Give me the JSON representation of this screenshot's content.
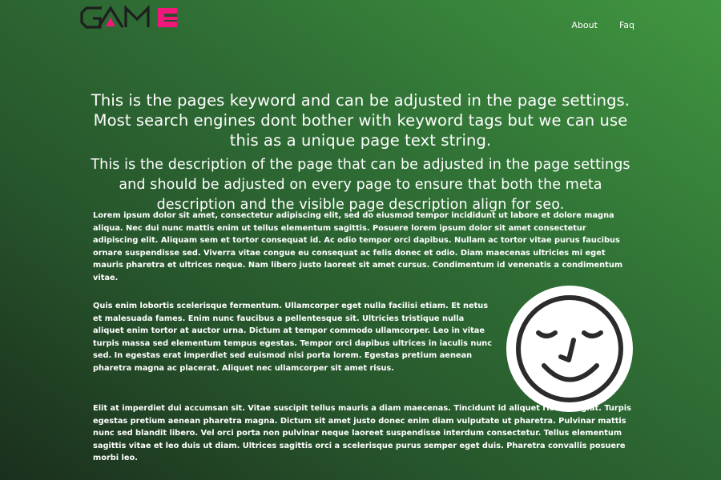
{
  "brand": {
    "logo_text": "GAME",
    "accent_color": "#f0187a"
  },
  "nav": {
    "about_label": "About",
    "faq_label": "Faq"
  },
  "hero": {
    "keyword": "This is the pages keyword and can be adjusted in the page settings. Most search engines dont bother with keyword tags but we can use this as a unique page text string.",
    "description": "This is the description of the page that can be adjusted in the page settings and should be adjusted on every page to ensure that both the meta description and the visible page description align for seo."
  },
  "content": {
    "paragraph_1": "Lorem ipsum dolor sit amet, consectetur adipiscing elit, sed do eiusmod tempor incididunt ut labore et dolore magna aliqua. Nec dui nunc mattis enim ut tellus elementum sagittis. Posuere lorem ipsum dolor sit amet consectetur adipiscing elit. Aliquam sem et tortor consequat id. Ac odio tempor orci dapibus. Nullam ac tortor vitae purus faucibus ornare suspendisse sed. Viverra vitae congue eu consequat ac felis donec et odio. Diam maecenas ultricies mi eget mauris pharetra et ultrices neque. Nam libero justo laoreet sit amet cursus. Condimentum id venenatis a condimentum vitae.",
    "paragraph_2": "Quis enim lobortis scelerisque fermentum. Ullamcorper eget nulla facilisi etiam. Et netus et malesuada fames. Enim nunc faucibus a pellentesque sit. Ultricies tristique nulla aliquet enim tortor at auctor urna. Dictum at tempor commodo ullamcorper. Leo in vitae turpis massa sed elementum tempus egestas. Tempor orci dapibus ultrices in iaculis nunc sed. In egestas erat imperdiet sed euismod nisi porta lorem. Egestas pretium aenean pharetra magna ac placerat. Aliquet nec ullamcorper sit amet risus.",
    "paragraph_3": "Elit at imperdiet dui accumsan sit. Vitae suscipit tellus mauris a diam maecenas. Tincidunt id aliquet risus feugiat. Turpis egestas pretium aenean pharetra magna. Dictum sit amet justo donec enim diam vulputate ut pharetra. Pulvinar mattis nunc sed blandit libero. Vel orci porta non pulvinar neque laoreet suspendisse interdum consectetur. Tellus elementum sagittis vitae et leo duis ut diam. Ultrices sagittis orci a scelerisque purus semper eget duis. Pharetra convallis posuere morbi leo."
  },
  "image": {
    "icon": "smiley-face-icon"
  }
}
